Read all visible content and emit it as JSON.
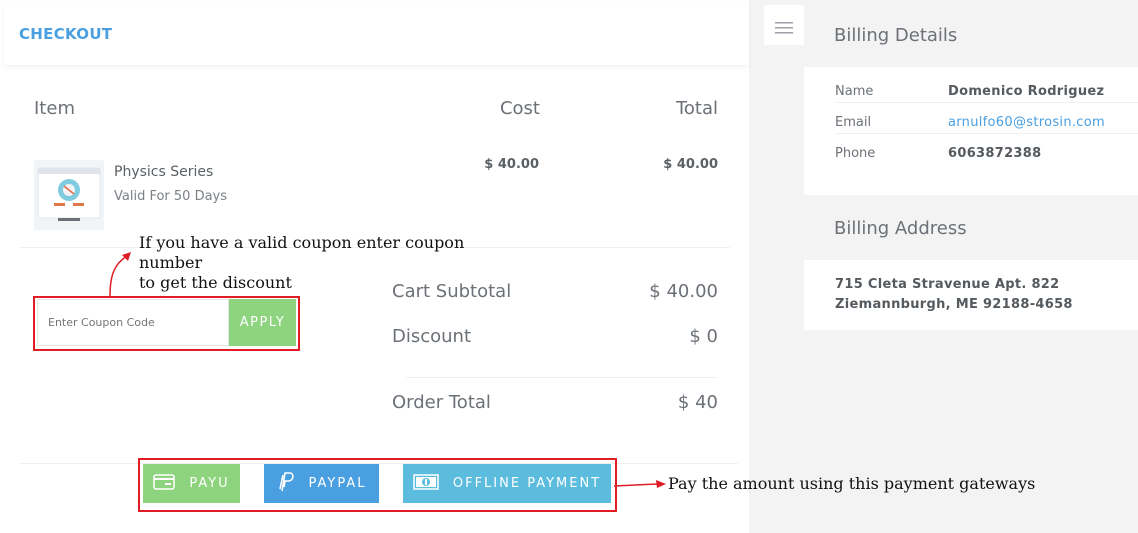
{
  "header": {
    "title": "CHECKOUT"
  },
  "table": {
    "headers": [
      "Item",
      "Cost",
      "Total"
    ],
    "rows": [
      {
        "name": "Physics Series",
        "validity": "Valid For 50 Days",
        "cost": "$ 40.00",
        "total": "$ 40.00"
      }
    ]
  },
  "coupon": {
    "placeholder": "Enter Coupon Code",
    "apply_label": "APPLY"
  },
  "summary": {
    "subtotal_label": "Cart Subtotal",
    "subtotal_value": "$ 40.00",
    "discount_label": "Discount",
    "discount_value": "$ 0",
    "order_total_label": "Order Total",
    "order_total_value": "$ 40"
  },
  "annotations": {
    "coupon_line1": "If you have a valid coupon enter coupon number",
    "coupon_line2": "to get the discount",
    "payment": "Pay the amount using this payment gateways"
  },
  "payments": [
    {
      "label": "PAYU",
      "icon": "credit-card-icon",
      "color": "#8ed47f"
    },
    {
      "label": "PAYPAL",
      "icon": "paypal-icon",
      "color": "#4a9fe0"
    },
    {
      "label": "OFFLINE PAYMENT",
      "icon": "cash-icon",
      "color": "#5bbcde"
    }
  ],
  "billing_details": {
    "title": "Billing Details",
    "name_label": "Name",
    "name_value": "Domenico Rodriguez",
    "email_label": "Email",
    "email_value": "arnulfo60@strosin.com",
    "phone_label": "Phone",
    "phone_value": "6063872388"
  },
  "billing_address": {
    "title": "Billing Address",
    "line1": "715 Cleta Stravenue Apt. 822",
    "line2": "Ziemannburgh, ME 92188-4658"
  },
  "colors": {
    "accent": "#4a9fe0",
    "annotation_red": "#e01c24"
  }
}
